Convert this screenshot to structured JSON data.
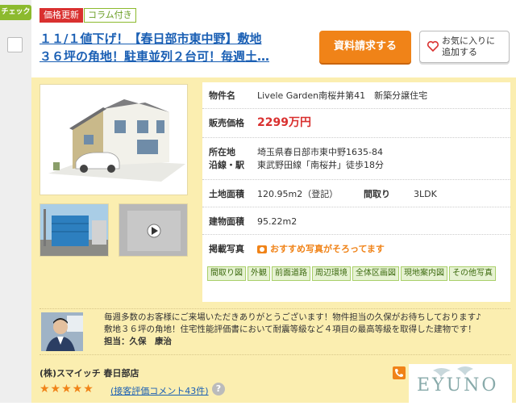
{
  "check": {
    "label": "チェック"
  },
  "header": {
    "badges": [
      "価格更新",
      "コラム付き"
    ],
    "title_line1": "１１/１値下げ！【春日部市東中野】敷地",
    "title_line2": "３６坪の角地！駐車並列２台可！毎週土…",
    "request_button": "資料請求する",
    "favorite_button_line1": "お気に入りに",
    "favorite_button_line2": "追加する"
  },
  "property": {
    "name_label": "物件名",
    "name": "Livele Garden南桜井第41　新築分譲住宅",
    "price_label": "販売価格",
    "price": "2299万円",
    "location_label": "所在地",
    "location": "埼玉県春日部市東中野1635-84",
    "station_label": "沿線・駅",
    "station": "東武野田線「南桜井」徒歩18分",
    "land_area_label": "土地面積",
    "land_area": "120.95m2（登記）",
    "layout_label": "間取り",
    "layout": "3LDK",
    "building_area_label": "建物面積",
    "building_area": "95.22m2",
    "photos_label": "掲載写真",
    "photos_note": "おすすめ写真がそろってます",
    "photo_tags": [
      "間取り図",
      "外観",
      "前面道路",
      "周辺環境",
      "全体区画図",
      "現地案内図",
      "その他写真"
    ]
  },
  "agent": {
    "message_line1": "毎週多数のお客様にご来場いただきありがとうございます！物件担当の久保がお待ちしております♪",
    "message_line2": "敷地３６坪の角地！住宅性能評価書において耐震等級など４項目の最高等級を取得した建物です！",
    "name_line": "担当：久保　康治"
  },
  "company": {
    "name": "(株)スマイッチ 春日部店",
    "stars": "★★★★★",
    "rating": 5,
    "review_link": "(接客評価コメント43件)",
    "help": "?",
    "logo_text": "EYUNO"
  },
  "colors": {
    "accent": "#f08318",
    "price": "#d9302f",
    "link": "#1a5fb4",
    "panel": "#fbeeb0",
    "tag": "#a9cf6a"
  }
}
